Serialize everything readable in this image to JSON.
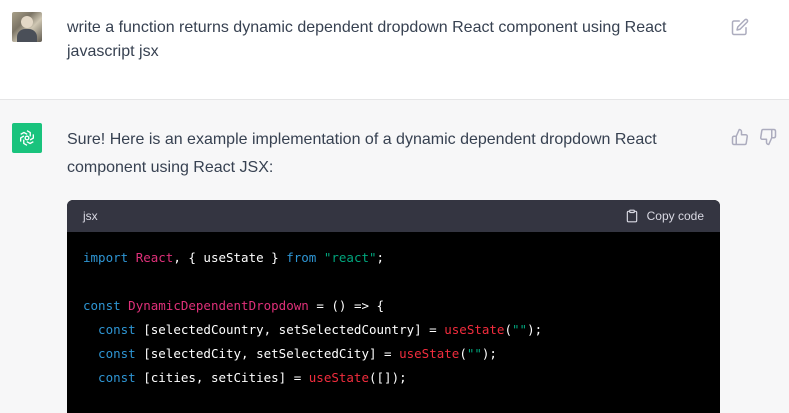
{
  "user_message": {
    "text": "write a function returns dynamic dependent dropdown React component using React javascript jsx"
  },
  "assistant_message": {
    "text": "Sure! Here is an example implementation of a dynamic dependent dropdown React component using React JSX:"
  },
  "code_block": {
    "language": "jsx",
    "copy_label": "Copy code",
    "lines": {
      "l1": {
        "a": "import",
        "b": " ",
        "c": "React",
        "d": ", { useState } ",
        "e": "from",
        "f": " ",
        "g": "\"react\"",
        "h": ";"
      },
      "l3": {
        "a": "const",
        "b": " ",
        "c": "DynamicDependentDropdown",
        "d": " = () => {"
      },
      "l4": {
        "a": "  const",
        "b": " [selectedCountry, setSelectedCountry] = ",
        "c": "useState",
        "d": "(",
        "e": "\"\"",
        "f": ");"
      },
      "l5": {
        "a": "  const",
        "b": " [selectedCity, setSelectedCity] = ",
        "c": "useState",
        "d": "(",
        "e": "\"\"",
        "f": ");"
      },
      "l6": {
        "a": "  const",
        "b": " [cities, setCities] = ",
        "c": "useState",
        "d": "([]);"
      }
    }
  },
  "colors": {
    "user_bg": "#ffffff",
    "assistant_bg": "#f7f7f8",
    "bot_avatar": "#19c37d",
    "code_header": "#343541",
    "code_bg": "#000000",
    "keyword": "#2e95d3",
    "component_name": "#df3079",
    "function_call": "#f22c3d",
    "string": "#00a67d"
  },
  "icons": [
    "user-avatar",
    "edit-icon",
    "openai-logo-icon",
    "thumbs-up-icon",
    "thumbs-down-icon",
    "clipboard-icon"
  ]
}
